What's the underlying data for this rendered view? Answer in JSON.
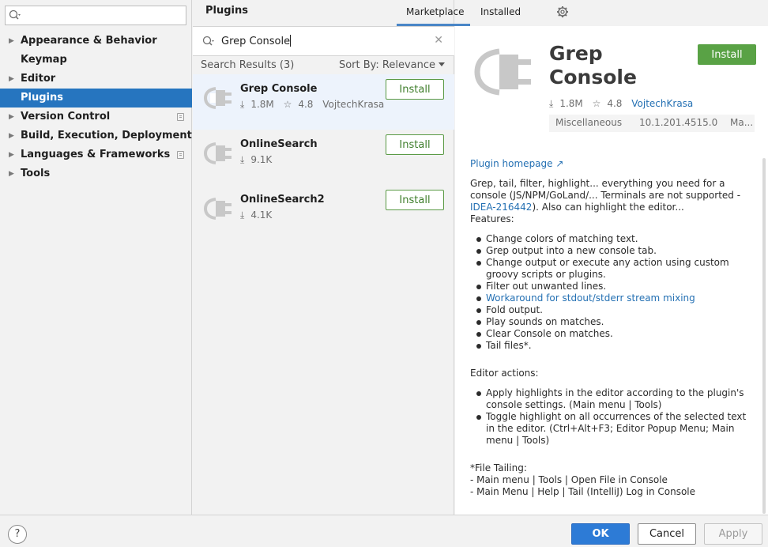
{
  "sidebar": {
    "search_placeholder": "",
    "items": [
      {
        "label": "Appearance & Behavior"
      },
      {
        "label": "Keymap"
      },
      {
        "label": "Editor"
      },
      {
        "label": "Plugins"
      },
      {
        "label": "Version Control"
      },
      {
        "label": "Build, Execution, Deployment"
      },
      {
        "label": "Languages & Frameworks"
      },
      {
        "label": "Tools"
      }
    ]
  },
  "header": {
    "title": "Plugins",
    "tabs": [
      {
        "label": "Marketplace"
      },
      {
        "label": "Installed"
      }
    ]
  },
  "search": {
    "value": "Grep Console",
    "results_count": "Search Results (3)",
    "sort_label": "Sort By: Relevance"
  },
  "plugins": [
    {
      "name": "Grep Console",
      "downloads": "1.8M",
      "rating": "4.8",
      "vendor": "VojtechKrasa",
      "install_label": "Install"
    },
    {
      "name": "OnlineSearch",
      "downloads": "9.1K",
      "install_label": "Install"
    },
    {
      "name": "OnlineSearch2",
      "downloads": "4.1K",
      "install_label": "Install"
    }
  ],
  "detail": {
    "title": "Grep Console",
    "install_label": "Install",
    "downloads": "1.8M",
    "rating": "4.8",
    "vendor": "VojtechKrasa",
    "category": "Miscellaneous",
    "version": "10.1.201.4515.0",
    "extra": "Ma...",
    "homepage_label": "Plugin homepage ↗",
    "desc_part1": "Grep, tail, filter, highlight... everything you need for a console (JS/NPM/GoLand/... Terminals are not supported - ",
    "desc_link": "IDEA-216442",
    "desc_part2": "). Also can highlight the editor...",
    "features_label": "Features:",
    "features": [
      "Change colors of matching text.",
      "Grep output into a new console tab.",
      "Change output or execute any action using custom groovy scripts or plugins.",
      "Filter out unwanted lines.",
      "Workaround for stdout/stderr stream mixing",
      "Fold output.",
      "Play sounds on matches.",
      "Clear Console on matches.",
      "Tail files*."
    ],
    "editor_actions_label": "Editor actions:",
    "editor_actions": [
      "Apply highlights in the editor according to the plugin's console settings. (Main menu | Tools)",
      "Toggle highlight on all occurrences of the selected text in the editor. (Ctrl+Alt+F3; Editor Popup Menu; Main menu | Tools)"
    ],
    "file_tailing_label": "*File Tailing:",
    "file_tailing_lines": [
      "- Main menu | Tools | Open File in Console",
      "- Main Menu | Help | Tail (IntelliJ) Log in Console"
    ]
  },
  "footer": {
    "help_label": "?",
    "ok_label": "OK",
    "cancel_label": "Cancel",
    "apply_label": "Apply"
  },
  "colors": {
    "selection": "#2675bf",
    "install_green": "#59a245",
    "link": "#2470b3",
    "ok_blue": "#2d7bd6"
  }
}
